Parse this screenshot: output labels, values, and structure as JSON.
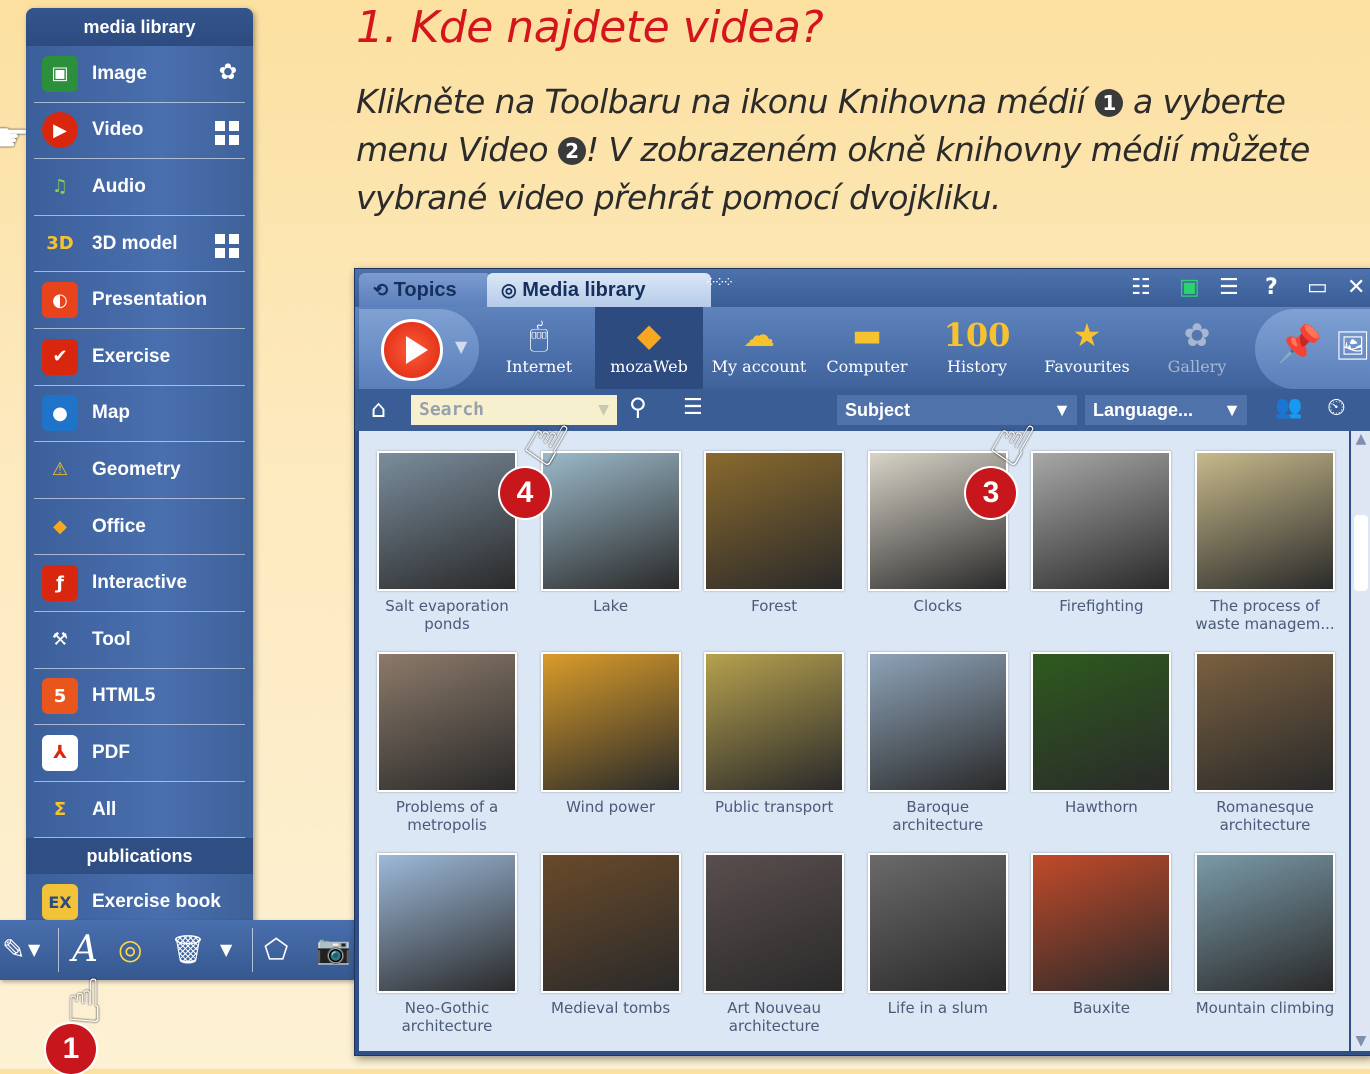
{
  "heading": {
    "title": "1. Kde najdete videa?",
    "line1a": "Klikněte na Toolbaru na ikonu Knihovna médií",
    "bullet1": "1",
    "line1b": "a vyberte menu Video",
    "bullet2": "2",
    "line1c": "!  V zobrazeném okně knihovny médií můžete vybrané video přehrát pomocí dvojkliku."
  },
  "sidebar": {
    "title": "media library",
    "items": [
      {
        "label": "Image",
        "icon": "image-icon"
      },
      {
        "label": "Video",
        "icon": "video-play-icon"
      },
      {
        "label": "Audio",
        "icon": "music-note-icon"
      },
      {
        "label": "3D model",
        "icon": "3d-icon"
      },
      {
        "label": "Presentation",
        "icon": "presentation-icon"
      },
      {
        "label": "Exercise",
        "icon": "exercise-check-icon"
      },
      {
        "label": "Map",
        "icon": "globe-icon"
      },
      {
        "label": "Geometry",
        "icon": "compass-icon"
      },
      {
        "label": "Office",
        "icon": "office-icon"
      },
      {
        "label": "Interactive",
        "icon": "flash-icon"
      },
      {
        "label": "Tool",
        "icon": "hammer-icon"
      },
      {
        "label": "HTML5",
        "icon": "html5-icon"
      },
      {
        "label": "PDF",
        "icon": "pdf-icon"
      },
      {
        "label": "All",
        "icon": "sigma-icon"
      }
    ],
    "publications_title": "publications",
    "publication_item": "Exercise book"
  },
  "window": {
    "tabs": [
      "Topics",
      "Media library"
    ],
    "ribbon": [
      "Internet",
      "mozaWeb",
      "My account",
      "Computer",
      "History",
      "Favourites",
      "Gallery"
    ],
    "history_badge": "100",
    "search_placeholder": "Search",
    "subject": "Subject",
    "language": "Language...",
    "items": [
      [
        "Salt evaporation ponds",
        "Lake",
        "Forest",
        "Clocks",
        "Firefighting",
        "The process of waste managem..."
      ],
      [
        "Problems of a metropolis",
        "Wind power",
        "Public transport",
        "Baroque architecture",
        "Hawthorn",
        "Romanesque architecture"
      ],
      [
        "Neo-Gothic architecture",
        "Medieval tombs",
        "Art Nouveau architecture",
        "Life in a slum",
        "Bauxite",
        "Mountain climbing"
      ]
    ]
  },
  "markers": [
    "1",
    "3",
    "4"
  ],
  "colors": {
    "accent": "#d4151c",
    "panel": "#4a6fae",
    "grid": "#dbe7f5"
  }
}
